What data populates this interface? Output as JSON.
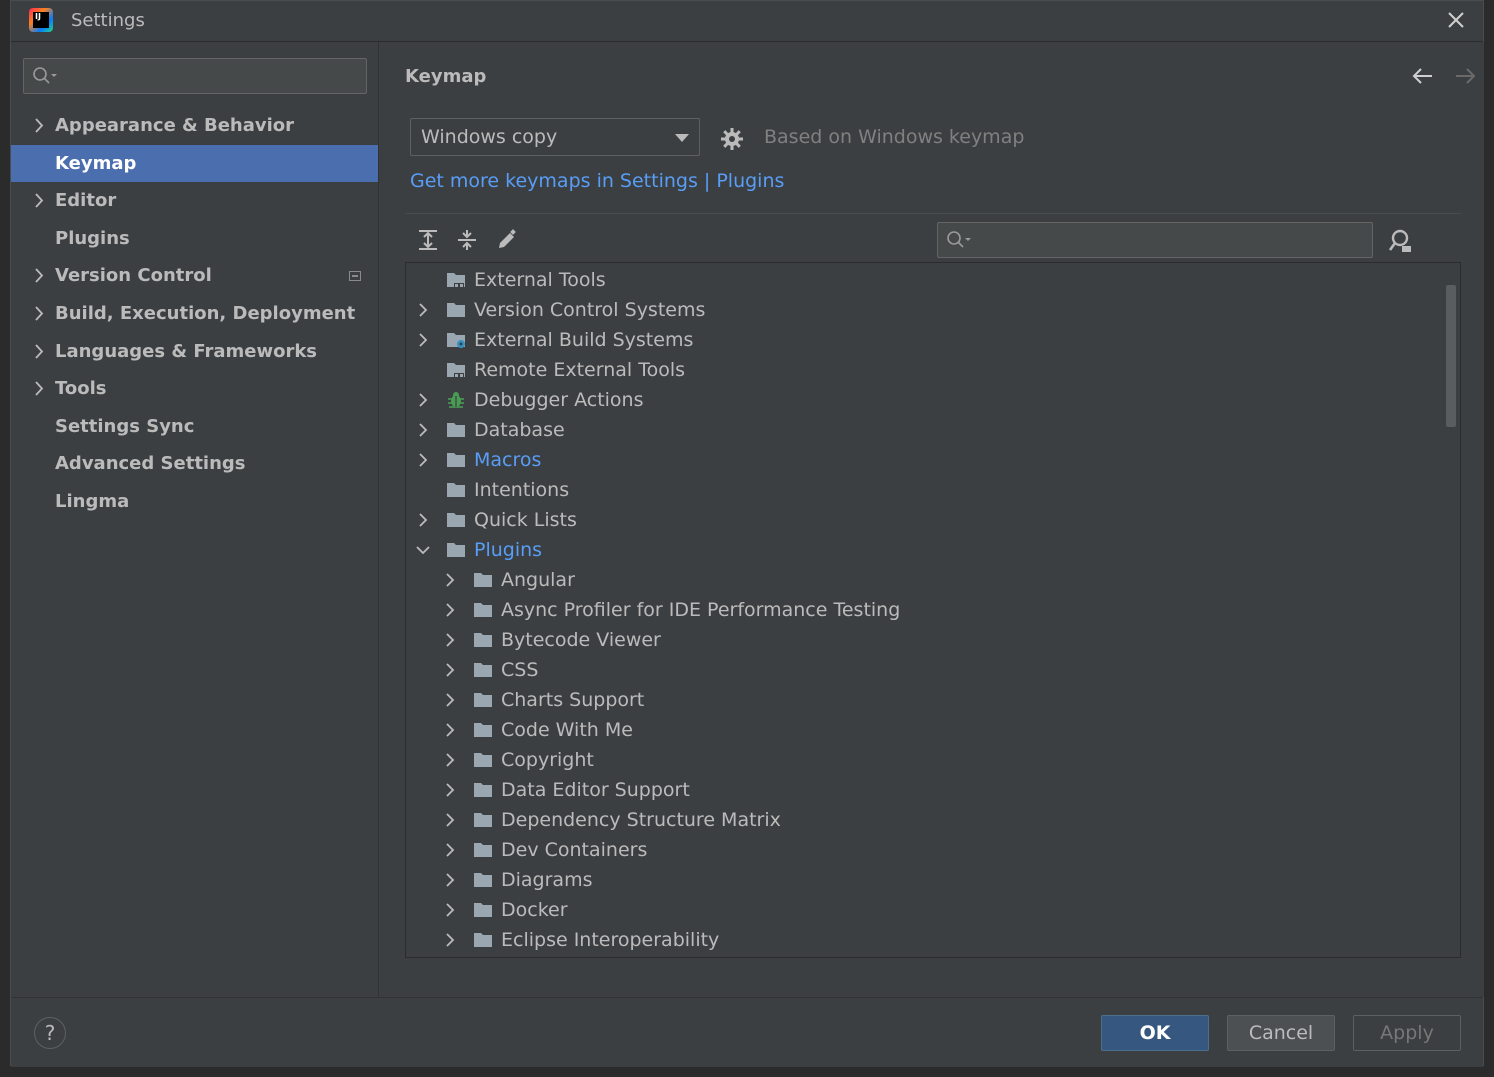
{
  "window": {
    "title": "Settings"
  },
  "sidebar": {
    "search_placeholder": "",
    "items": [
      {
        "label": "Appearance & Behavior",
        "expandable": true
      },
      {
        "label": "Keymap",
        "expandable": false,
        "selected": true
      },
      {
        "label": "Editor",
        "expandable": true
      },
      {
        "label": "Plugins",
        "expandable": false
      },
      {
        "label": "Version Control",
        "expandable": true
      },
      {
        "label": "Build, Execution, Deployment",
        "expandable": true
      },
      {
        "label": "Languages & Frameworks",
        "expandable": true
      },
      {
        "label": "Tools",
        "expandable": true
      },
      {
        "label": "Settings Sync",
        "expandable": false
      },
      {
        "label": "Advanced Settings",
        "expandable": false
      },
      {
        "label": "Lingma",
        "expandable": false
      }
    ]
  },
  "main": {
    "title": "Keymap",
    "keymap_select": {
      "value": "Windows copy"
    },
    "based_on": "Based on Windows keymap",
    "get_more_link": "Get more keymaps in Settings | Plugins",
    "action_search_placeholder": ""
  },
  "tree": [
    {
      "label": "External Tools",
      "level": 0,
      "expandable": false,
      "icon": "tools-folder-icon"
    },
    {
      "label": "Version Control Systems",
      "level": 0,
      "expandable": true,
      "icon": "folder-icon"
    },
    {
      "label": "External Build Systems",
      "level": 0,
      "expandable": true,
      "icon": "build-folder-icon"
    },
    {
      "label": "Remote External Tools",
      "level": 0,
      "expandable": false,
      "icon": "tools-folder-icon"
    },
    {
      "label": "Debugger Actions",
      "level": 0,
      "expandable": true,
      "icon": "bug-icon"
    },
    {
      "label": "Database",
      "level": 0,
      "expandable": true,
      "icon": "folder-icon"
    },
    {
      "label": "Macros",
      "level": 0,
      "expandable": true,
      "icon": "folder-icon",
      "link": true
    },
    {
      "label": "Intentions",
      "level": 0,
      "expandable": false,
      "icon": "folder-icon"
    },
    {
      "label": "Quick Lists",
      "level": 0,
      "expandable": true,
      "icon": "folder-icon"
    },
    {
      "label": "Plugins",
      "level": 0,
      "expandable": true,
      "expanded": true,
      "icon": "folder-icon",
      "link": true
    },
    {
      "label": "Angular",
      "level": 1,
      "expandable": true,
      "icon": "folder-icon"
    },
    {
      "label": "Async Profiler for IDE Performance Testing",
      "level": 1,
      "expandable": true,
      "icon": "folder-icon"
    },
    {
      "label": "Bytecode Viewer",
      "level": 1,
      "expandable": true,
      "icon": "folder-icon"
    },
    {
      "label": "CSS",
      "level": 1,
      "expandable": true,
      "icon": "folder-icon"
    },
    {
      "label": "Charts Support",
      "level": 1,
      "expandable": true,
      "icon": "folder-icon"
    },
    {
      "label": "Code With Me",
      "level": 1,
      "expandable": true,
      "icon": "folder-icon"
    },
    {
      "label": "Copyright",
      "level": 1,
      "expandable": true,
      "icon": "folder-icon"
    },
    {
      "label": "Data Editor Support",
      "level": 1,
      "expandable": true,
      "icon": "folder-icon"
    },
    {
      "label": "Dependency Structure Matrix",
      "level": 1,
      "expandable": true,
      "icon": "folder-icon"
    },
    {
      "label": "Dev Containers",
      "level": 1,
      "expandable": true,
      "icon": "folder-icon"
    },
    {
      "label": "Diagrams",
      "level": 1,
      "expandable": true,
      "icon": "folder-icon"
    },
    {
      "label": "Docker",
      "level": 1,
      "expandable": true,
      "icon": "folder-icon"
    },
    {
      "label": "Eclipse Interoperability",
      "level": 1,
      "expandable": true,
      "icon": "folder-icon"
    }
  ],
  "footer": {
    "help": "?",
    "ok": "OK",
    "cancel": "Cancel",
    "apply": "Apply"
  },
  "colors": {
    "background": "#3c3f41",
    "selection": "#4b6eaf",
    "link": "#589df6",
    "primary_button": "#365880"
  }
}
